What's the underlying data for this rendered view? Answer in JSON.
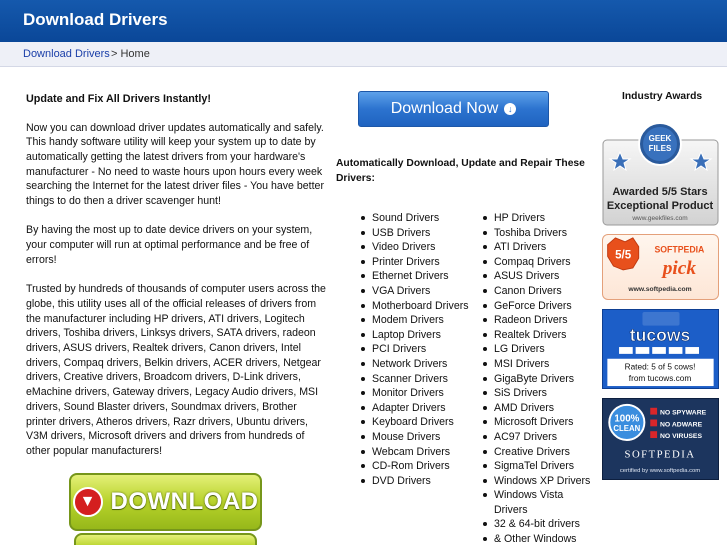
{
  "header": {
    "site_title": "Download Drivers"
  },
  "breadcrumb": {
    "link": "Download Drivers",
    "sep_current": "> Home"
  },
  "main": {
    "heading": "Update and Fix All Drivers Instantly!",
    "paragraphs": [
      "Now you can download driver updates automatically and safely. This handy software utility will keep your system up to date by automatically getting the latest drivers from your hardware's manufacturer - No need to waste hours upon hours every week searching the Internet for the latest driver files - You have better things to do then a driver scavenger hunt!",
      "By having the most up to date device drivers on your system, your computer will run at optimal performance and be free of errors!",
      "Trusted by hundreds of thousands of computer users across the globe, this utility uses all of the official releases of drivers from the manufacturer including HP drivers, ATI drivers, Logitech drivers, Toshiba drivers, Linksys drivers, SATA drivers, radeon drivers, ASUS drivers, Realtek drivers, Canon drivers, Intel drivers, Compaq drivers, Belkin drivers, ACER drivers, Netgear drivers, Creative drivers, Broadcom drivers, D-Link drivers, eMachine drivers, Gateway drivers, Legacy Audio drivers, MSI drivers, Sound Blaster drivers, Soundmax drivers, Brother printer drivers, Atheros drivers, Razr drivers, Ubuntu drivers, V3M drivers, Microsoft drivers and drivers from hundreds of other popular manufacturers!"
    ],
    "download_button_big": "DOWNLOAD"
  },
  "center": {
    "download_now_label": "Download Now",
    "auto_heading": "Automatically Download, Update and Repair These Drivers:",
    "list_a": [
      "Sound Drivers",
      "USB Drivers",
      "Video Drivers",
      "Printer Drivers",
      "Ethernet Drivers",
      "VGA Drivers",
      "Motherboard Drivers",
      "Modem Drivers",
      "Laptop Drivers",
      "PCI Drivers",
      "Network Drivers",
      "Scanner Drivers",
      "Monitor Drivers",
      "Adapter Drivers",
      "Keyboard Drivers",
      "Mouse Drivers",
      "Webcam Drivers",
      "CD-Rom Drivers",
      "DVD Drivers"
    ],
    "list_b": [
      "HP Drivers",
      "Toshiba Drivers",
      "ATI Drivers",
      "Compaq Drivers",
      "ASUS Drivers",
      "Canon Drivers",
      "GeForce Drivers",
      "Radeon Drivers",
      "Realtek Drivers",
      "LG Drivers",
      "MSI Drivers",
      "GigaByte Drivers",
      "SiS Drivers",
      "AMD Drivers",
      "Microsoft Drivers",
      "AC97 Drivers",
      "Creative Drivers",
      "SigmaTel Drivers",
      "Windows XP Drivers",
      "Windows Vista Drivers",
      "32 & 64-bit drivers",
      "& Other Windows"
    ]
  },
  "awards": {
    "title": "Industry Awards",
    "geek": {
      "logo": "GEEK FILES",
      "line1": "Awarded 5/5 Stars",
      "line2": "Exceptional Product",
      "url": "www.geekfiles.com"
    },
    "softpedia_pick": {
      "score": "5/5",
      "brand": "SOFTPEDIA",
      "word": "pick",
      "url": "www.softpedia.com"
    },
    "tucows": {
      "brand": "tucows",
      "line1": "Rated: 5 of 5 cows!",
      "line2": "from tucows.com"
    },
    "clean": {
      "pct": "100%",
      "word": "CLEAN",
      "items": [
        "NO SPYWARE",
        "NO ADWARE",
        "NO VIRUSES"
      ],
      "brand": "SOFTPEDIA",
      "cert": "certified by www.softpedia.com"
    },
    "colors": {
      "softpedia_orange": "#e8501c",
      "tucows_blue": "#1c5ec8",
      "clean_navy": "#1c355e"
    }
  }
}
